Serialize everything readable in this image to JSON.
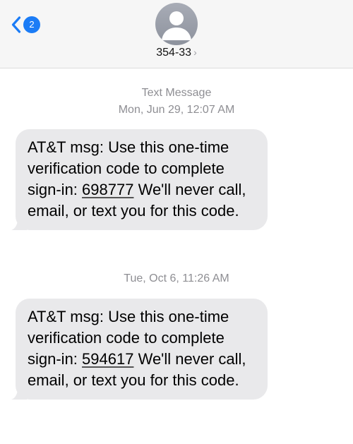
{
  "header": {
    "back_badge": "2",
    "contact_name": "354-33",
    "contact_chevron": "›"
  },
  "messages": [
    {
      "service_label": "Text Message",
      "timestamp_day": "Mon, Jun 29,",
      "timestamp_time": "12:07 AM",
      "text_before": "AT&T msg: Use this one-time verification code to complete sign-in: ",
      "code": "698777",
      "text_after": " We'll never call, email, or text you for this code."
    },
    {
      "timestamp_day": "Tue, Oct 6,",
      "timestamp_time": "11:26 AM",
      "text_before": "AT&T msg: Use this one-time verification code to complete sign-in: ",
      "code": "594617",
      "text_after": " We'll never call, email, or text you for this code."
    }
  ],
  "colors": {
    "header_bg": "#f6f6f6",
    "accent_blue": "#1b7cf6",
    "bubble_gray": "#e9e9eb",
    "timestamp_gray": "#8e8e93"
  },
  "icons": [
    "chevron-left-icon",
    "person-silhouette-icon",
    "chevron-right-icon"
  ]
}
